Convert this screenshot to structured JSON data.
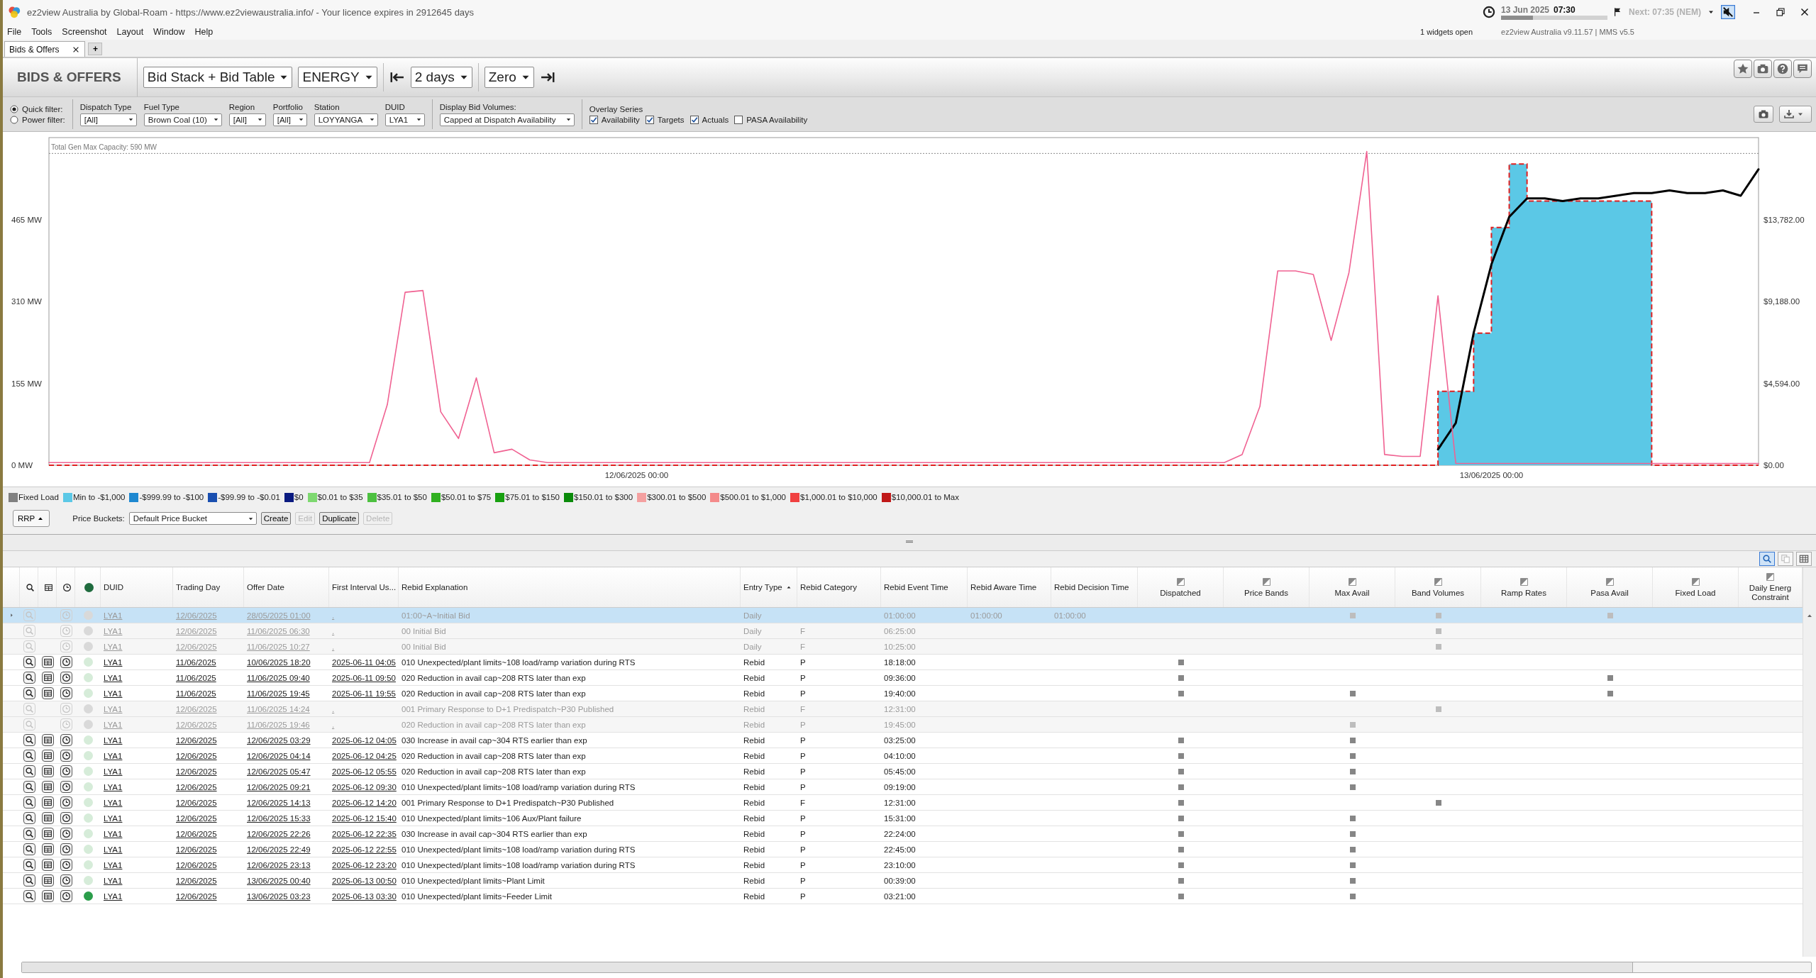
{
  "window": {
    "title": "ez2view Australia by Global-Roam - https://www.ez2viewaustralia.info/ - Your licence expires in 2912645 days"
  },
  "menu": [
    "File",
    "Tools",
    "Screenshot",
    "Layout",
    "Window",
    "Help"
  ],
  "status": {
    "date": "13 Jun 2025",
    "time": "07:30",
    "level": 0.3,
    "next": "Next: 07:35 (NEM)",
    "widgets": "1 widgets open",
    "version": "ez2view Australia v9.11.57 | MMS v5.5"
  },
  "tabs": [
    {
      "label": "Bids & Offers",
      "selected": true
    }
  ],
  "add_tab": "+",
  "toolbar": {
    "title": "BIDS & OFFERS",
    "view": "Bid Stack + Bid Table",
    "market": "ENERGY",
    "range": "2 days",
    "baseline": "Zero"
  },
  "filters": {
    "modes": [
      {
        "label": "Quick filter:",
        "selected": true
      },
      {
        "label": "Power filter:",
        "selected": false
      }
    ],
    "dropdowns": [
      {
        "label": "Dispatch Type",
        "value": "[All]"
      },
      {
        "label": "Fuel Type",
        "value": "Brown Coal (10)"
      },
      {
        "label": "Region",
        "value": "[All]"
      },
      {
        "label": "Portfolio",
        "value": "[All]"
      },
      {
        "label": "Station",
        "value": "LOYYANGA"
      },
      {
        "label": "DUID",
        "value": "LYA1"
      }
    ],
    "bid_volumes": {
      "label": "Display Bid Volumes:",
      "value": "Capped at Dispatch Availability"
    },
    "overlay": {
      "label": "Overlay Series",
      "options": [
        {
          "label": "Availability",
          "checked": true
        },
        {
          "label": "Targets",
          "checked": true
        },
        {
          "label": "Actuals",
          "checked": true
        },
        {
          "label": "PASA Availability",
          "checked": false
        }
      ]
    }
  },
  "chart": {
    "chart_data": {
      "type": "area",
      "ylim": [
        0,
        620
      ],
      "y2lim": [
        0,
        18377
      ],
      "categories": [
        null,
        null,
        null,
        null,
        null,
        null,
        null,
        null,
        null,
        null,
        null,
        null,
        null,
        null,
        null,
        null,
        null,
        null,
        null,
        null,
        null,
        null,
        null,
        null,
        null,
        null,
        null,
        null,
        null,
        null,
        null,
        null,
        null,
        "12/06/2025 00:00",
        null,
        null,
        null,
        null,
        null,
        null,
        null,
        null,
        null,
        null,
        null,
        null,
        null,
        null,
        null,
        null,
        null,
        null,
        null,
        null,
        null,
        null,
        null,
        null,
        null,
        null,
        null,
        null,
        null,
        null,
        null,
        null,
        null,
        null,
        null,
        null,
        null,
        null,
        null,
        null,
        null,
        null,
        null,
        null,
        null,
        null,
        null,
        "13/06/2025 00:00",
        null,
        null,
        null,
        null,
        null,
        null,
        null,
        null,
        null,
        null,
        null,
        null,
        null,
        null,
        null
      ],
      "yticks": [
        {
          "value": 0,
          "label": "0 MW"
        },
        {
          "value": 155,
          "label": "155 MW"
        },
        {
          "value": 310,
          "label": "310 MW"
        },
        {
          "value": 465,
          "label": "465 MW"
        }
      ],
      "y2ticks": [
        {
          "value": 0,
          "label": "$0.00"
        },
        {
          "value": 4594,
          "label": "$4,594.00"
        },
        {
          "value": 9188,
          "label": "$9,188.00"
        },
        {
          "value": 13782,
          "label": "$13,782.00"
        }
      ],
      "ref_lines": [
        {
          "axis": "y",
          "value": 590,
          "label": "Total Gen Max Capacity: 590 MW"
        }
      ],
      "series": [
        {
          "type": "area",
          "color": "#5bc8e6",
          "values": [
            0,
            0,
            0,
            0,
            0,
            0,
            0,
            0,
            0,
            0,
            0,
            0,
            0,
            0,
            0,
            0,
            0,
            0,
            0,
            0,
            0,
            0,
            0,
            0,
            0,
            0,
            0,
            0,
            0,
            0,
            0,
            0,
            0,
            0,
            0,
            0,
            0,
            0,
            0,
            0,
            0,
            0,
            0,
            0,
            0,
            0,
            0,
            0,
            0,
            0,
            0,
            0,
            0,
            0,
            0,
            0,
            0,
            0,
            0,
            0,
            0,
            0,
            0,
            0,
            0,
            0,
            0,
            0,
            0,
            0,
            0,
            0,
            0,
            0,
            0,
            0,
            0,
            0,
            140,
            140,
            250,
            450,
            570,
            500,
            500,
            500,
            500,
            500,
            500,
            500,
            0,
            0,
            0,
            0,
            0,
            0,
            0
          ]
        },
        {
          "type": "line",
          "color": "#000000",
          "values": [
            null,
            null,
            null,
            null,
            null,
            null,
            null,
            null,
            null,
            null,
            null,
            null,
            null,
            null,
            null,
            null,
            null,
            null,
            null,
            null,
            null,
            null,
            null,
            null,
            null,
            null,
            null,
            null,
            null,
            null,
            null,
            null,
            null,
            null,
            null,
            null,
            null,
            null,
            null,
            null,
            null,
            null,
            null,
            null,
            null,
            null,
            null,
            null,
            null,
            null,
            null,
            null,
            null,
            null,
            null,
            null,
            null,
            null,
            null,
            null,
            null,
            null,
            null,
            null,
            null,
            null,
            null,
            null,
            null,
            null,
            null,
            null,
            null,
            null,
            null,
            null,
            null,
            null,
            30,
            80,
            250,
            380,
            470,
            505,
            505,
            500,
            505,
            505,
            510,
            515,
            515,
            520,
            515,
            515,
            520,
            510,
            560
          ]
        },
        {
          "type": "line",
          "axis": "y2",
          "color": "#f06292",
          "values": [
            150,
            150,
            150,
            150,
            150,
            150,
            150,
            150,
            150,
            150,
            150,
            150,
            150,
            150,
            150,
            150,
            150,
            150,
            150,
            3400,
            9700,
            9800,
            3000,
            1500,
            4900,
            700,
            900,
            300,
            150,
            150,
            150,
            150,
            150,
            150,
            150,
            150,
            150,
            150,
            150,
            150,
            150,
            150,
            150,
            150,
            150,
            150,
            150,
            150,
            150,
            150,
            150,
            150,
            150,
            150,
            150,
            150,
            150,
            150,
            150,
            150,
            150,
            150,
            150,
            150,
            150,
            150,
            150,
            600,
            3300,
            10900,
            10900,
            10700,
            7000,
            10800,
            17600,
            600,
            500,
            500,
            9500,
            100,
            100,
            100,
            100,
            100,
            100,
            100,
            100,
            100,
            100,
            100,
            100,
            100,
            100,
            100,
            100,
            100,
            100
          ]
        }
      ]
    }
  },
  "legend": [
    {
      "label": "Fixed Load",
      "color": "#808080"
    },
    {
      "label": "Min to -$1,000",
      "color": "#5bc8e6"
    },
    {
      "label": "-$999.99 to -$100",
      "color": "#1e88d0"
    },
    {
      "label": "-$99.99 to -$0.01",
      "color": "#1a4fb0"
    },
    {
      "label": "$0",
      "color": "#0a1a80"
    },
    {
      "label": "$0.01 to $35",
      "color": "#7ed870"
    },
    {
      "label": "$35.01 to $50",
      "color": "#4cc040"
    },
    {
      "label": "$50.01 to $75",
      "color": "#30b020"
    },
    {
      "label": "$75.01 to $150",
      "color": "#18a010"
    },
    {
      "label": "$150.01 to $300",
      "color": "#0a8a0a"
    },
    {
      "label": "$300.01 to $500",
      "color": "#f4a0a0"
    },
    {
      "label": "$500.01 to $1,000",
      "color": "#f48a8a"
    },
    {
      "label": "$1,000.01 to $10,000",
      "color": "#f04040"
    },
    {
      "label": "$10,000.01 to Max",
      "color": "#c01818"
    }
  ],
  "price_buckets": {
    "rrp": "RRP",
    "label": "Price Buckets:",
    "value": "Default Price Bucket",
    "buttons": [
      {
        "label": "Create",
        "disabled": false
      },
      {
        "label": "Edit",
        "disabled": true
      },
      {
        "label": "Duplicate",
        "disabled": false
      },
      {
        "label": "Delete",
        "disabled": true
      }
    ]
  },
  "table": {
    "columns": [
      {
        "label": "DUID",
        "kind": "text",
        "sorted": false
      },
      {
        "label": "Trading Day",
        "kind": "text",
        "sorted": false
      },
      {
        "label": "Offer Date",
        "kind": "text",
        "sorted": false
      },
      {
        "label": "First Interval Us...",
        "kind": "text",
        "sorted": false
      },
      {
        "label": "Rebid Explanation",
        "kind": "text",
        "sorted": false
      },
      {
        "label": "Entry Type",
        "kind": "text",
        "sorted": true
      },
      {
        "label": "Rebid Category",
        "kind": "text",
        "sorted": false
      },
      {
        "label": "Rebid Event Time",
        "kind": "text",
        "sorted": false
      },
      {
        "label": "Rebid Aware Time",
        "kind": "text",
        "sorted": false
      },
      {
        "label": "Rebid Decision Time",
        "kind": "text",
        "sorted": false
      },
      {
        "label": "Dispatched",
        "kind": "flag",
        "sorted": false
      },
      {
        "label": "Price Bands",
        "kind": "flag",
        "sorted": false
      },
      {
        "label": "Max Avail",
        "kind": "flag",
        "sorted": false
      },
      {
        "label": "Band Volumes",
        "kind": "flag",
        "sorted": false
      },
      {
        "label": "Ramp Rates",
        "kind": "flag",
        "sorted": false
      },
      {
        "label": "Pasa Avail",
        "kind": "flag",
        "sorted": false
      },
      {
        "label": "Fixed Load",
        "kind": "flag",
        "sorted": false
      },
      {
        "label": "Daily Energ Constraint",
        "kind": "flag",
        "sorted": false
      }
    ],
    "rows": [
      {
        "selected": true,
        "active": false,
        "color": "#d9d9d9",
        "duid": "LYA1",
        "trading_day": "12/06/2025",
        "offer_date": "28/05/2025 01:00",
        "first_interval": ".",
        "explanation": "01:00~A~Initial Bid",
        "entry_type": "Daily",
        "event_time": "01:00:00",
        "aware_time": "01:00:00",
        "decision_time": "01:00:00",
        "flags": [
          false,
          false,
          true,
          true,
          false,
          true,
          false,
          false
        ]
      },
      {
        "selected": false,
        "active": false,
        "color": "#d9d9d9",
        "duid": "LYA1",
        "trading_day": "12/06/2025",
        "offer_date": "11/06/2025 06:30",
        "first_interval": ".",
        "explanation": "00 Initial Bid",
        "entry_type": "Daily",
        "category": "F",
        "event_time": "06:25:00",
        "flags": [
          false,
          false,
          false,
          true,
          false,
          false,
          false,
          false
        ]
      },
      {
        "selected": false,
        "active": false,
        "color": "#d9d9d9",
        "duid": "LYA1",
        "trading_day": "12/06/2025",
        "offer_date": "11/06/2025 10:27",
        "first_interval": ".",
        "explanation": "00 Initial Bid",
        "entry_type": "Daily",
        "category": "F",
        "event_time": "10:25:00",
        "flags": [
          false,
          false,
          false,
          true,
          false,
          false,
          false,
          false
        ]
      },
      {
        "selected": false,
        "active": true,
        "color": "#d6ecd9",
        "duid": "LYA1",
        "trading_day": "11/06/2025",
        "offer_date": "10/06/2025 18:20",
        "first_interval": "2025-06-11 04:05",
        "explanation": "010 Unexpected/plant limits~108 load/ramp variation during RTS",
        "entry_type": "Rebid",
        "category": "P",
        "event_time": "18:18:00",
        "flags": [
          true,
          false,
          false,
          false,
          false,
          false,
          false,
          false
        ]
      },
      {
        "selected": false,
        "active": true,
        "color": "#d6ecd9",
        "duid": "LYA1",
        "trading_day": "11/06/2025",
        "offer_date": "11/06/2025 09:40",
        "first_interval": "2025-06-11 09:50",
        "explanation": "020 Reduction in avail cap~208 RTS later than exp",
        "entry_type": "Rebid",
        "category": "P",
        "event_time": "09:36:00",
        "flags": [
          true,
          false,
          false,
          false,
          false,
          true,
          false,
          false
        ]
      },
      {
        "selected": false,
        "active": true,
        "color": "#d6ecd9",
        "duid": "LYA1",
        "trading_day": "11/06/2025",
        "offer_date": "11/06/2025 19:45",
        "first_interval": "2025-06-11 19:55",
        "explanation": "020 Reduction in avail cap~208 RTS later than exp",
        "entry_type": "Rebid",
        "category": "P",
        "event_time": "19:40:00",
        "flags": [
          true,
          false,
          true,
          false,
          false,
          true,
          false,
          false
        ]
      },
      {
        "selected": false,
        "active": false,
        "color": "#d9d9d9",
        "duid": "LYA1",
        "trading_day": "12/06/2025",
        "offer_date": "11/06/2025 14:24",
        "first_interval": ".",
        "explanation": "001 Primary Response to D+1 Predispatch~P30 Published",
        "entry_type": "Rebid",
        "category": "F",
        "event_time": "12:31:00",
        "flags": [
          false,
          false,
          false,
          true,
          false,
          false,
          false,
          false
        ]
      },
      {
        "selected": false,
        "active": false,
        "color": "#d9d9d9",
        "duid": "LYA1",
        "trading_day": "12/06/2025",
        "offer_date": "11/06/2025 19:46",
        "first_interval": ".",
        "explanation": "020 Reduction in avail cap~208 RTS later than exp",
        "entry_type": "Rebid",
        "category": "P",
        "event_time": "19:45:00",
        "flags": [
          false,
          false,
          true,
          false,
          false,
          false,
          false,
          false
        ]
      },
      {
        "selected": false,
        "active": true,
        "color": "#d6ecd9",
        "duid": "LYA1",
        "trading_day": "12/06/2025",
        "offer_date": "12/06/2025 03:29",
        "first_interval": "2025-06-12 04:05",
        "explanation": "030 Increase in avail cap~304 RTS earlier than exp",
        "entry_type": "Rebid",
        "category": "P",
        "event_time": "03:25:00",
        "flags": [
          true,
          false,
          true,
          false,
          false,
          false,
          false,
          false
        ]
      },
      {
        "selected": false,
        "active": true,
        "color": "#d6ecd9",
        "duid": "LYA1",
        "trading_day": "12/06/2025",
        "offer_date": "12/06/2025 04:14",
        "first_interval": "2025-06-12 04:25",
        "explanation": "020 Reduction in avail cap~208 RTS later than exp",
        "entry_type": "Rebid",
        "category": "P",
        "event_time": "04:10:00",
        "flags": [
          true,
          false,
          true,
          false,
          false,
          false,
          false,
          false
        ]
      },
      {
        "selected": false,
        "active": true,
        "color": "#d6ecd9",
        "duid": "LYA1",
        "trading_day": "12/06/2025",
        "offer_date": "12/06/2025 05:47",
        "first_interval": "2025-06-12 05:55",
        "explanation": "020 Reduction in avail cap~208 RTS later than exp",
        "entry_type": "Rebid",
        "category": "P",
        "event_time": "05:45:00",
        "flags": [
          true,
          false,
          true,
          false,
          false,
          false,
          false,
          false
        ]
      },
      {
        "selected": false,
        "active": true,
        "color": "#d6ecd9",
        "duid": "LYA1",
        "trading_day": "12/06/2025",
        "offer_date": "12/06/2025 09:21",
        "first_interval": "2025-06-12 09:30",
        "explanation": "010 Unexpected/plant limits~108 load/ramp variation during RTS",
        "entry_type": "Rebid",
        "category": "P",
        "event_time": "09:19:00",
        "flags": [
          true,
          false,
          true,
          false,
          false,
          false,
          false,
          false
        ]
      },
      {
        "selected": false,
        "active": true,
        "color": "#d6ecd9",
        "duid": "LYA1",
        "trading_day": "12/06/2025",
        "offer_date": "12/06/2025 14:13",
        "first_interval": "2025-06-12 14:20",
        "explanation": "001 Primary Response to D+1 Predispatch~P30 Published",
        "entry_type": "Rebid",
        "category": "F",
        "event_time": "12:31:00",
        "flags": [
          true,
          false,
          false,
          true,
          false,
          false,
          false,
          false
        ]
      },
      {
        "selected": false,
        "active": true,
        "color": "#d6ecd9",
        "duid": "LYA1",
        "trading_day": "12/06/2025",
        "offer_date": "12/06/2025 15:33",
        "first_interval": "2025-06-12 15:40",
        "explanation": "010 Unexpected/plant limits~106 Aux/Plant failure",
        "entry_type": "Rebid",
        "category": "P",
        "event_time": "15:31:00",
        "flags": [
          true,
          false,
          true,
          false,
          false,
          false,
          false,
          false
        ]
      },
      {
        "selected": false,
        "active": true,
        "color": "#d6ecd9",
        "duid": "LYA1",
        "trading_day": "12/06/2025",
        "offer_date": "12/06/2025 22:26",
        "first_interval": "2025-06-12 22:35",
        "explanation": "030 Increase in avail cap~304 RTS earlier than exp",
        "entry_type": "Rebid",
        "category": "P",
        "event_time": "22:24:00",
        "flags": [
          true,
          false,
          true,
          false,
          false,
          false,
          false,
          false
        ]
      },
      {
        "selected": false,
        "active": true,
        "color": "#d6ecd9",
        "duid": "LYA1",
        "trading_day": "12/06/2025",
        "offer_date": "12/06/2025 22:49",
        "first_interval": "2025-06-12 22:55",
        "explanation": "010 Unexpected/plant limits~108 load/ramp variation during RTS",
        "entry_type": "Rebid",
        "category": "P",
        "event_time": "22:45:00",
        "flags": [
          true,
          false,
          true,
          false,
          false,
          false,
          false,
          false
        ]
      },
      {
        "selected": false,
        "active": true,
        "color": "#d6ecd9",
        "duid": "LYA1",
        "trading_day": "12/06/2025",
        "offer_date": "12/06/2025 23:13",
        "first_interval": "2025-06-12 23:20",
        "explanation": "010 Unexpected/plant limits~108 load/ramp variation during RTS",
        "entry_type": "Rebid",
        "category": "P",
        "event_time": "23:10:00",
        "flags": [
          true,
          false,
          true,
          false,
          false,
          false,
          false,
          false
        ]
      },
      {
        "selected": false,
        "active": true,
        "color": "#d6ecd9",
        "duid": "LYA1",
        "trading_day": "12/06/2025",
        "offer_date": "13/06/2025 00:40",
        "first_interval": "2025-06-13 00:50",
        "explanation": "010 Unexpected/plant limits~Plant Limit",
        "entry_type": "Rebid",
        "category": "P",
        "event_time": "00:39:00",
        "flags": [
          true,
          false,
          true,
          false,
          false,
          false,
          false,
          false
        ]
      },
      {
        "selected": false,
        "active": true,
        "color": "#2a9d4a",
        "duid": "LYA1",
        "trading_day": "12/06/2025",
        "offer_date": "13/06/2025 03:23",
        "first_interval": "2025-06-13 03:30",
        "explanation": "010 Unexpected/plant limits~Feeder Limit",
        "entry_type": "Rebid",
        "category": "P",
        "event_time": "03:21:00",
        "flags": [
          true,
          false,
          true,
          false,
          false,
          false,
          false,
          false
        ]
      }
    ]
  }
}
